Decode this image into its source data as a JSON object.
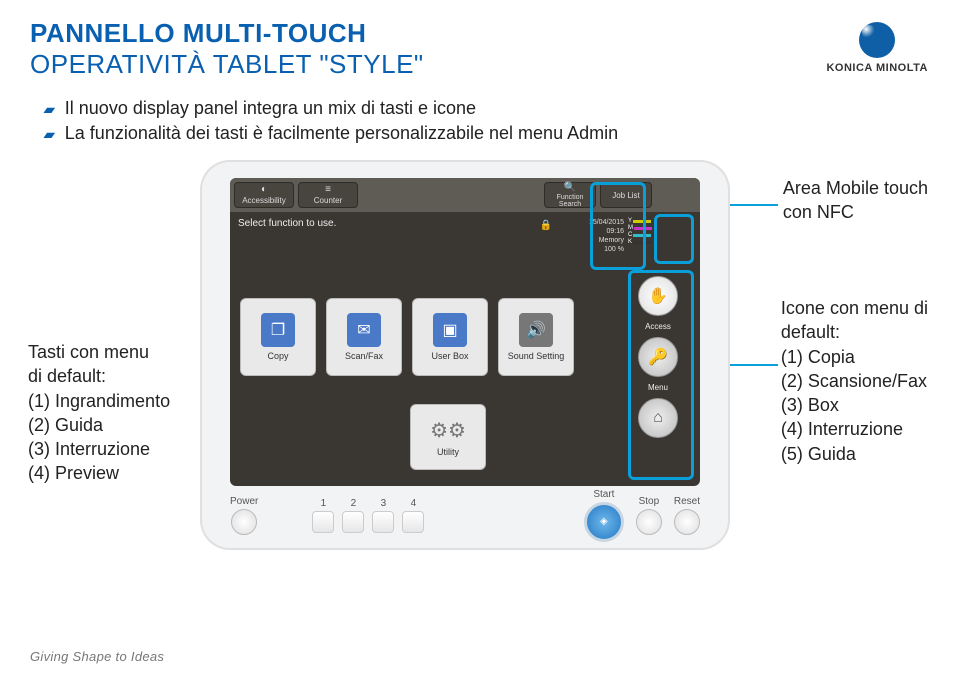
{
  "header": {
    "title_line1": "PANNELLO MULTI-TOUCH",
    "title_line2": "OPERATIVITÀ TABLET \"STYLE\"",
    "brand": "KONICA MINOLTA"
  },
  "bullets": [
    "Il nuovo display panel integra un mix di tasti e icone",
    "La funzionalità dei tasti è facilmente personalizzabile nel menu Admin"
  ],
  "screen": {
    "top_buttons": {
      "accessibility": "Accessibility",
      "counter": "Counter",
      "function_search": "Function Search",
      "job_list": "Job List"
    },
    "prompt": "Select function to use.",
    "datetime": {
      "date": "15/04/2015",
      "time": "09:16",
      "mem_label": "Memory",
      "mem": "100 %"
    },
    "toner_labels": [
      "Y",
      "M",
      "C",
      "K"
    ],
    "apps": {
      "copy": "Copy",
      "scanfax": "Scan/Fax",
      "userbox": "User Box",
      "sound": "Sound Setting"
    },
    "side_labels": {
      "access": "Access",
      "menu": "Menu"
    },
    "utility": "Utility"
  },
  "hw": {
    "power": "Power",
    "numbers": [
      "1",
      "2",
      "3",
      "4"
    ],
    "start": "Start",
    "stop": "Stop",
    "reset": "Reset"
  },
  "callouts": {
    "left_title": "Tasti con menu di default:",
    "left_items": [
      "(1)  Ingrandimento",
      "(2)  Guida",
      "(3)  Interruzione",
      "(4)  Preview"
    ],
    "right1": "Area Mobile touch con NFC",
    "right2_title": "Icone con menu di default:",
    "right2_items": [
      "(1)  Copia",
      "(2)  Scansione/Fax",
      "(3)  Box",
      "(4)  Interruzione",
      "(5)  Guida"
    ]
  },
  "footer": "Giving Shape to Ideas"
}
